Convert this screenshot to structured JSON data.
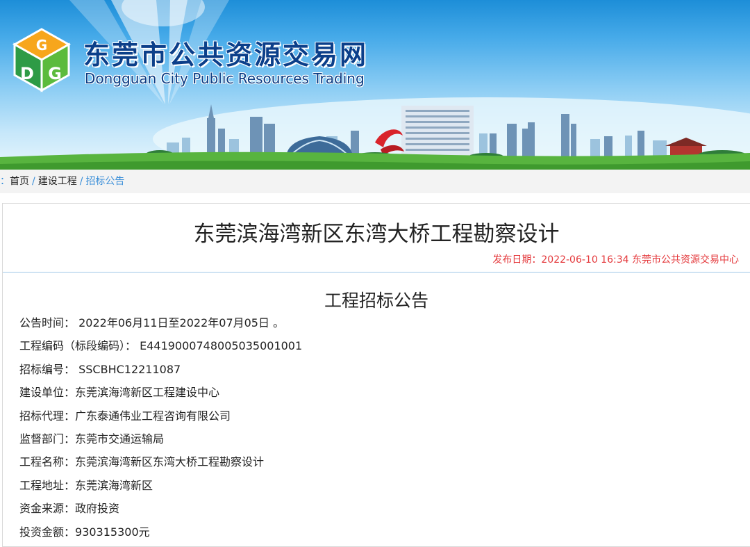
{
  "colors": {
    "title_blue": "#0b3f8a",
    "link_blue": "#3b8fd8",
    "publish_red": "#e4393c",
    "grass_green": "#58b43f"
  },
  "banner": {
    "title_cn": "东莞市公共资源交易网",
    "title_en": "Dongguan City Public Resources Trading",
    "logo_icon": "dg-cube-logo"
  },
  "breadcrumb": {
    "prefix": "置：",
    "items": [
      "首页",
      "建设工程",
      "招标公告"
    ],
    "separator": "/"
  },
  "notice": {
    "title": "东莞滨海湾新区东湾大桥工程勘察设计",
    "publish_label": "发布日期：",
    "publish_datetime": "2022-06-10 16:34",
    "publisher": "东莞市公共资源交易中心"
  },
  "content": {
    "subtitle": "工程招标公告",
    "fields": [
      {
        "label": "公告时间：",
        "value": " 2022年06月11日至2022年07月05日 。"
      },
      {
        "label": "工程编码（标段编码）：",
        "value": " E4419000748005035001001"
      },
      {
        "label": "招标编号：",
        "value": " SSCBHC12211087"
      },
      {
        "label": "建设单位：",
        "value": "东莞滨海湾新区工程建设中心"
      },
      {
        "label": "招标代理：",
        "value": "广东泰通伟业工程咨询有限公司"
      },
      {
        "label": "监督部门：",
        "value": "东莞市交通运输局"
      },
      {
        "label": "工程名称：",
        "value": "东莞滨海湾新区东湾大桥工程勘察设计"
      },
      {
        "label": "工程地址：",
        "value": "东莞滨海湾新区"
      },
      {
        "label": "资金来源：",
        "value": "政府投资"
      },
      {
        "label": "投资金额：",
        "value": "930315300元"
      }
    ]
  }
}
